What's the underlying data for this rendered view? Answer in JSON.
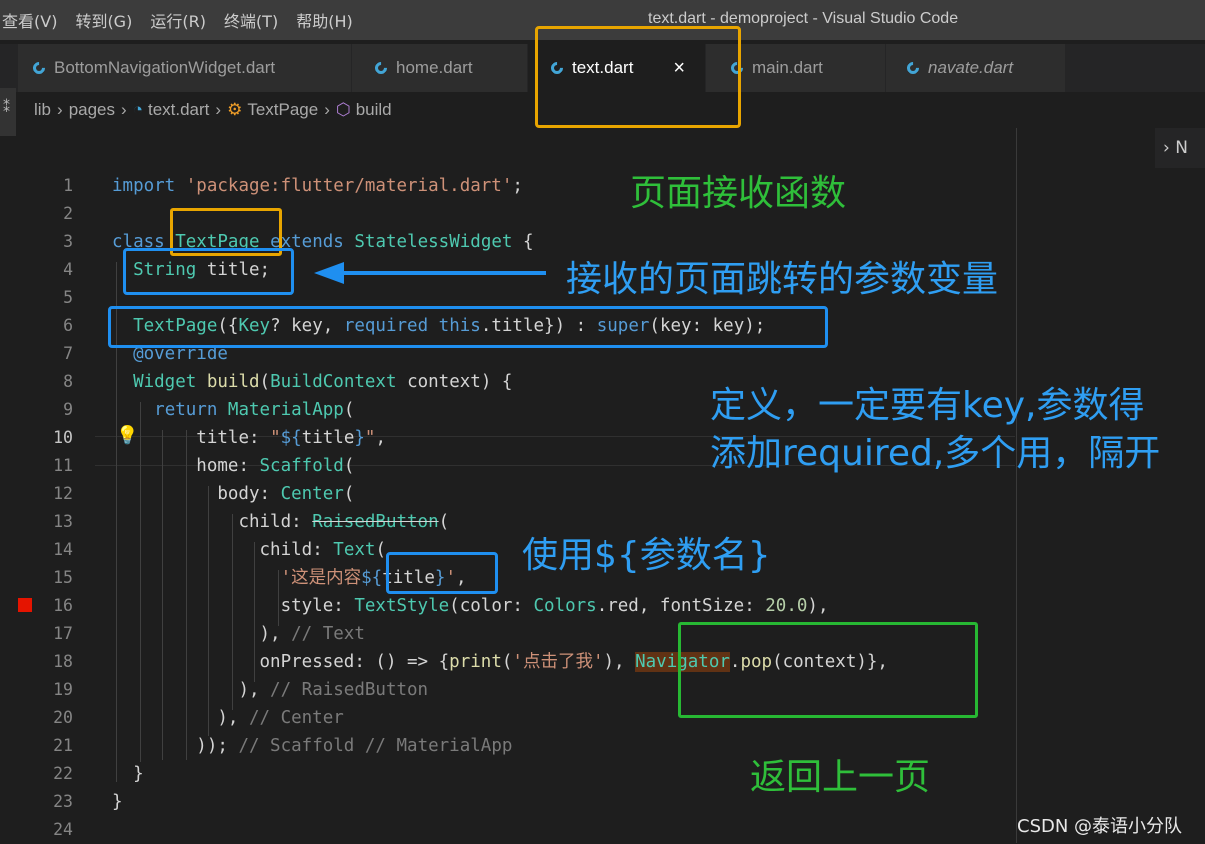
{
  "menu": [
    "查看(V)",
    "转到(G)",
    "运行(R)",
    "终端(T)",
    "帮助(H)"
  ],
  "window_title": "text.dart - demoproject - Visual Studio Code",
  "tabs": [
    {
      "label": "BottomNavigationWidget.dart",
      "italic": false
    },
    {
      "label": "home.dart",
      "italic": false
    },
    {
      "label": "text.dart",
      "italic": false,
      "active": true
    },
    {
      "label": "main.dart",
      "italic": false
    },
    {
      "label": "navate.dart",
      "italic": true
    }
  ],
  "tab_close": "×",
  "breadcrumb": [
    "lib",
    "pages",
    "text.dart",
    "TextPage",
    "build"
  ],
  "minimap_label": "N",
  "line_numbers": [
    "1",
    "2",
    "3",
    "4",
    "5",
    "6",
    "7",
    "8",
    "9",
    "10",
    "11",
    "12",
    "13",
    "14",
    "15",
    "16",
    "17",
    "18",
    "19",
    "20",
    "21",
    "22",
    "23",
    "24"
  ],
  "current_line": "10",
  "annotations": {
    "receive_func": "页面接收函数",
    "param_var": "接收的页面跳转的参数变量",
    "define_line1": "定义，一定要有key,参数得",
    "define_line2": "添加required,多个用，隔开",
    "use_param": "使用${参数名}",
    "go_back": "返回上一页"
  },
  "watermark": "CSDN @泰语小分队",
  "colors": {
    "yellow_box": "#e8a500",
    "blue_box": "#1f8ff0",
    "green_box": "#27b833",
    "green_text": "#2fbf3a",
    "blue_text": "#2f9ef2"
  }
}
